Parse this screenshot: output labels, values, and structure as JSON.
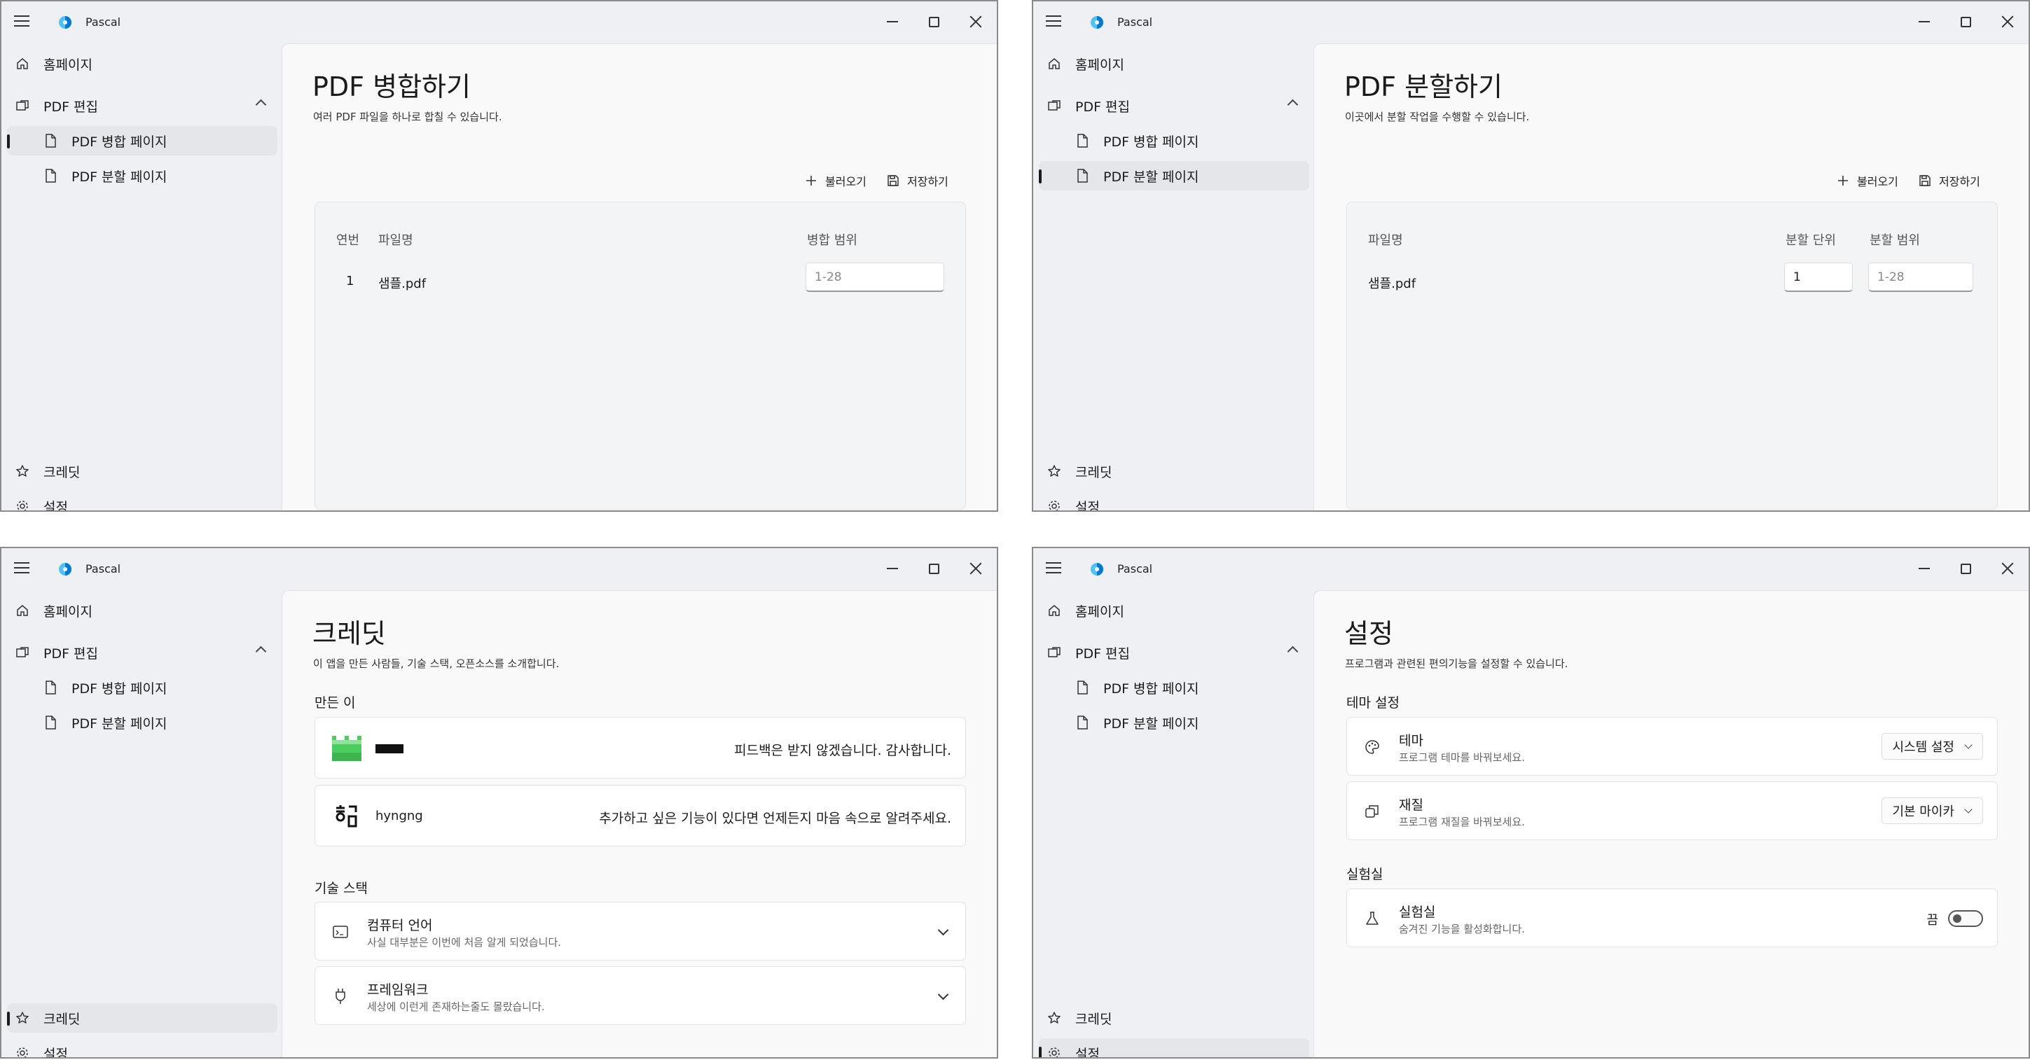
{
  "app": {
    "title": "Pascal",
    "accent": "#0078d4"
  },
  "nav": {
    "home": "홈페이지",
    "pdf_edit": "PDF 편집",
    "merge_page": "PDF 병합 페이지",
    "split_page": "PDF 분할 페이지",
    "credits": "크레딧",
    "settings": "설정"
  },
  "merge": {
    "title": "PDF 병합하기",
    "description": "여러 PDF 파일을 하나로 합칠 수 있습니다.",
    "load_label": "불러오기",
    "save_label": "저장하기",
    "columns": [
      "연번",
      "파일명",
      "병합 범위"
    ],
    "rows": [
      {
        "index": "1",
        "filename": "샘플.pdf",
        "range_placeholder": "1-28"
      }
    ]
  },
  "split": {
    "title": "PDF 분할하기",
    "description": "이곳에서 분할 작업을 수행할 수 있습니다.",
    "load_label": "불러오기",
    "save_label": "저장하기",
    "columns": [
      "파일명",
      "분할 단위",
      "분할 범위"
    ],
    "rows": [
      {
        "filename": "샘플.pdf",
        "unit_value": "1",
        "range_placeholder": "1-28"
      }
    ]
  },
  "credits": {
    "title": "크레딧",
    "description": "이 앱을 만든 사람들, 기술 스택, 오픈소스를 소개합니다.",
    "makers_heading": "만든 이",
    "makers": [
      {
        "name": "",
        "message": "피드백은 받지 않겠습니다. 감사합니다."
      },
      {
        "name": "hyngng",
        "message": "추가하고 싶은 기능이 있다면 언제든지 마음 속으로 알려주세요."
      }
    ],
    "tech_heading": "기술 스택",
    "tech": [
      {
        "title": "컴퓨터 언어",
        "subtitle": "사실 대부분은 이번에 처음 알게 되었습니다."
      },
      {
        "title": "프레임워크",
        "subtitle": "세상에 이런게 존재하는줄도 몰랐습니다."
      }
    ]
  },
  "settings": {
    "title": "설정",
    "description": "프로그램과 관련된 편의기능을 설정할 수 있습니다.",
    "theme_heading": "테마 설정",
    "theme": {
      "title": "테마",
      "subtitle": "프로그램 테마를 바꿔보세요.",
      "value": "시스템 설정"
    },
    "material": {
      "title": "재질",
      "subtitle": "프로그램 재질을 바꿔보세요.",
      "value": "기본 마이카"
    },
    "lab_heading": "실험실",
    "lab": {
      "title": "실험실",
      "subtitle": "숨겨진 기능을 활성화합니다.",
      "state_label": "끔",
      "enabled": false
    }
  }
}
